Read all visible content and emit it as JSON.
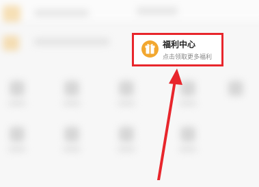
{
  "welfare_card": {
    "title": "福利中心",
    "subtitle": "点击领取更多福利",
    "icon": "gift-icon"
  },
  "annotation": {
    "highlight_color": "#e8262c",
    "arrow_color": "#e8262c"
  }
}
